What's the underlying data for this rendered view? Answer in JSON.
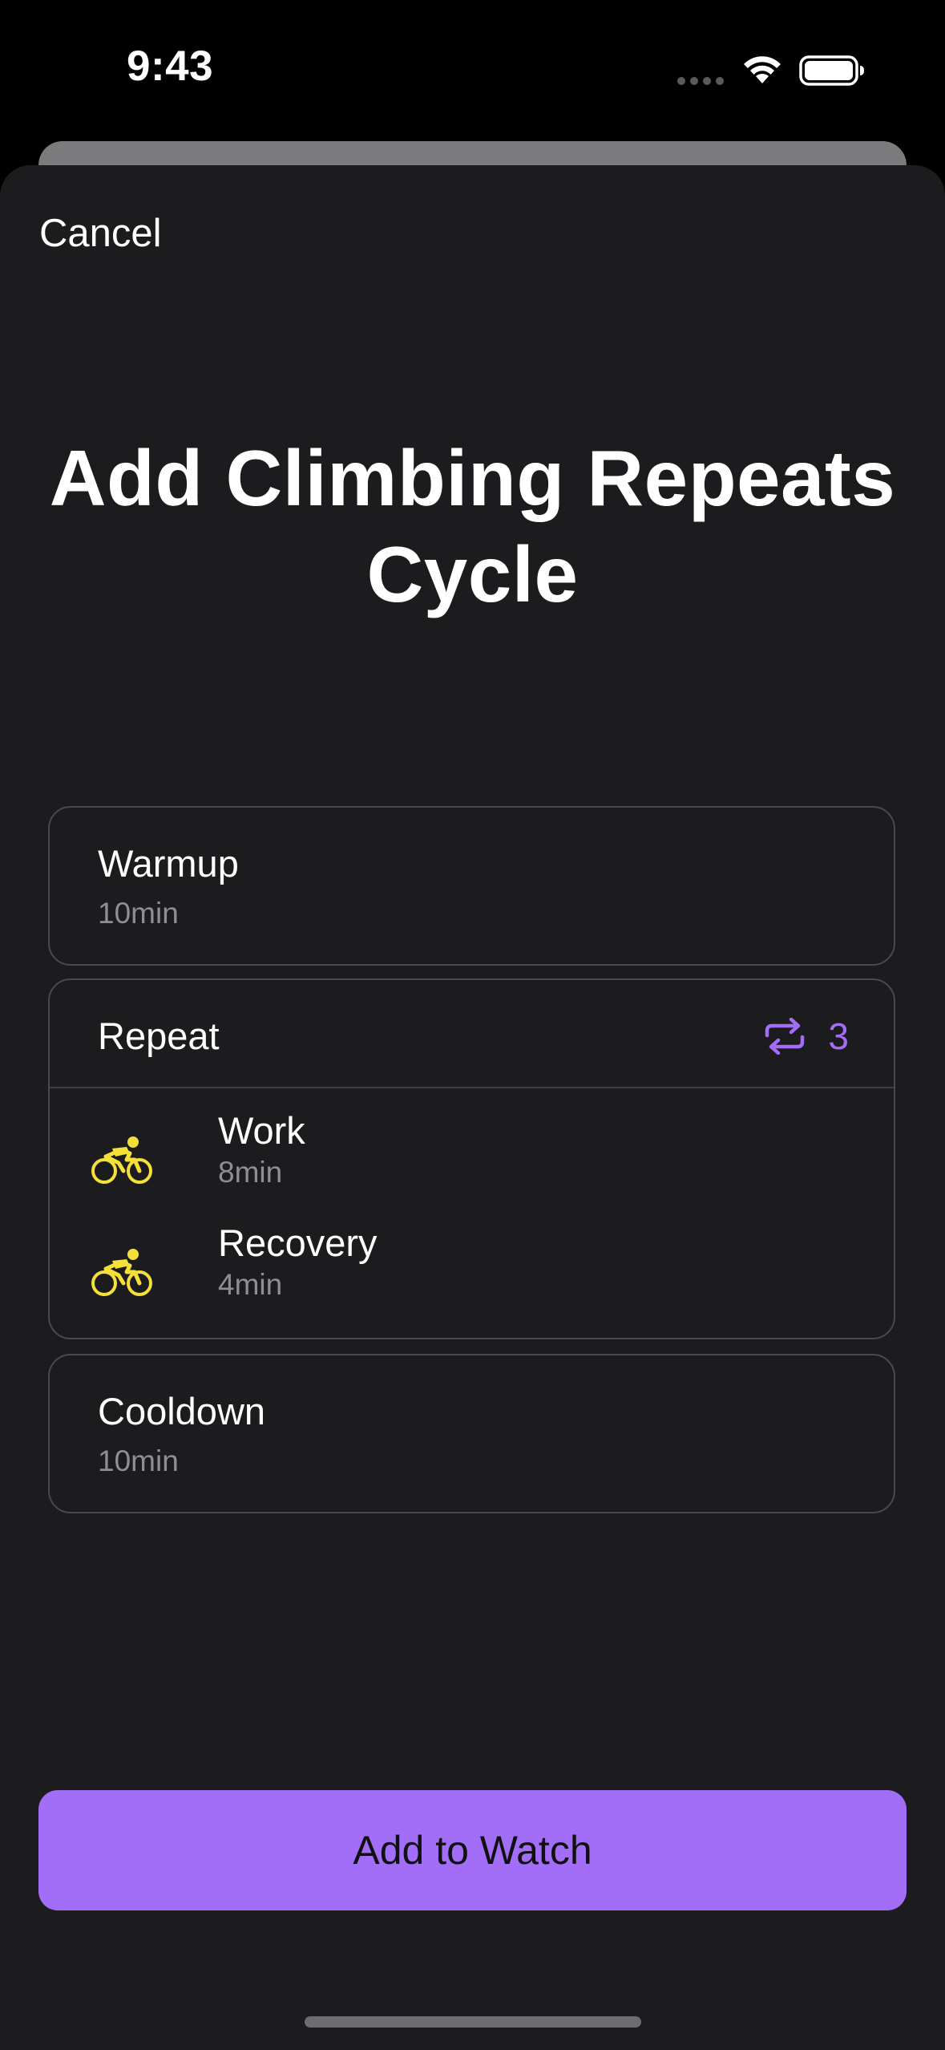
{
  "status_bar": {
    "time": "9:43"
  },
  "sheet": {
    "cancel_label": "Cancel",
    "title": "Add Climbing Repeats Cycle"
  },
  "steps": {
    "warmup": {
      "title": "Warmup",
      "duration": "10min"
    },
    "repeat": {
      "title": "Repeat",
      "count": "3",
      "items": [
        {
          "label": "Work",
          "duration": "8min",
          "icon": "cycling-icon"
        },
        {
          "label": "Recovery",
          "duration": "4min",
          "icon": "cycling-icon"
        }
      ]
    },
    "cooldown": {
      "title": "Cooldown",
      "duration": "10min"
    }
  },
  "actions": {
    "add_label": "Add to Watch"
  },
  "colors": {
    "accent": "#a36ef7",
    "icon_yellow": "#f5e03a",
    "sheet_bg": "#1c1c1e",
    "secondary_text": "#8e8e93"
  }
}
